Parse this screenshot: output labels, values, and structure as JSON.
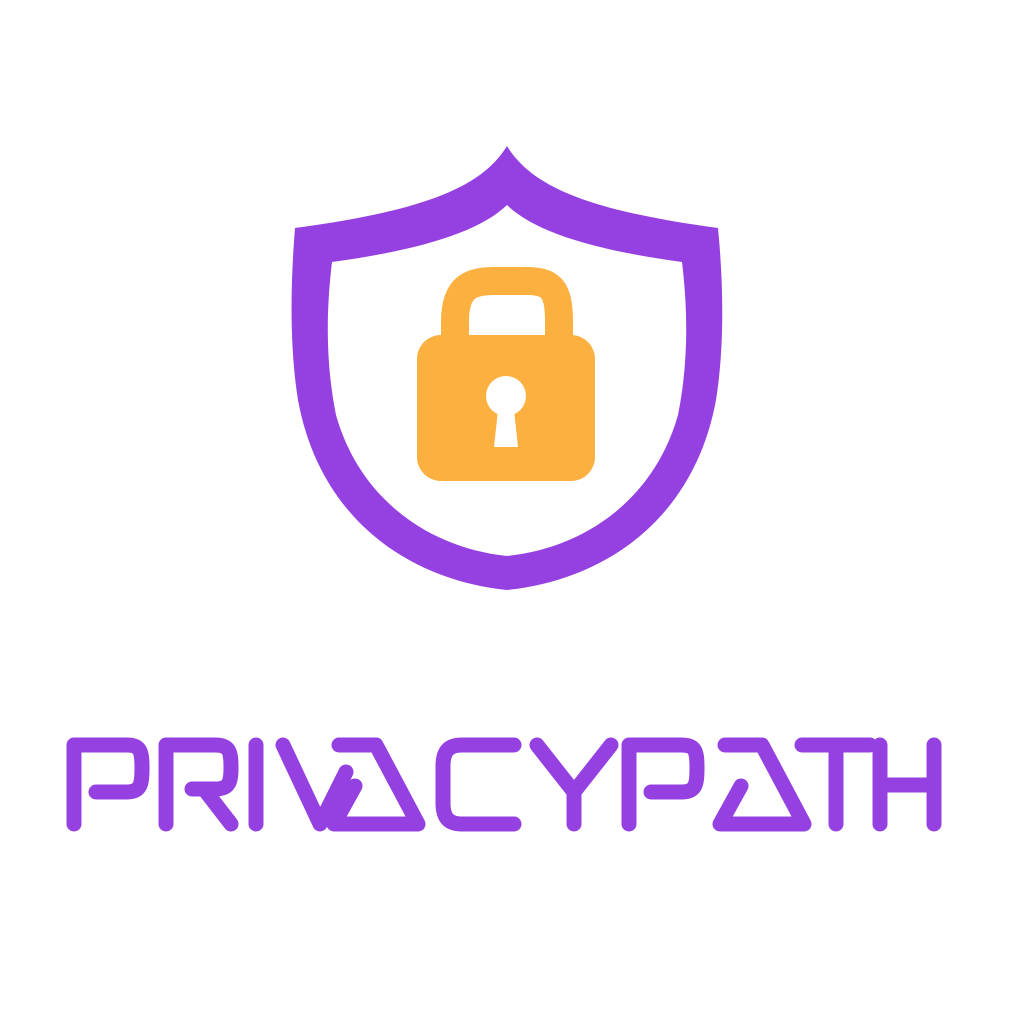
{
  "logo": {
    "wordmark": "PRIVACYPATH",
    "emblem_icon": "shield-lock-icon"
  },
  "colors": {
    "background": "#ffffff",
    "primary_purple": "#9541E1",
    "accent_orange": "#FBB040",
    "keyhole": "#ffffff"
  }
}
